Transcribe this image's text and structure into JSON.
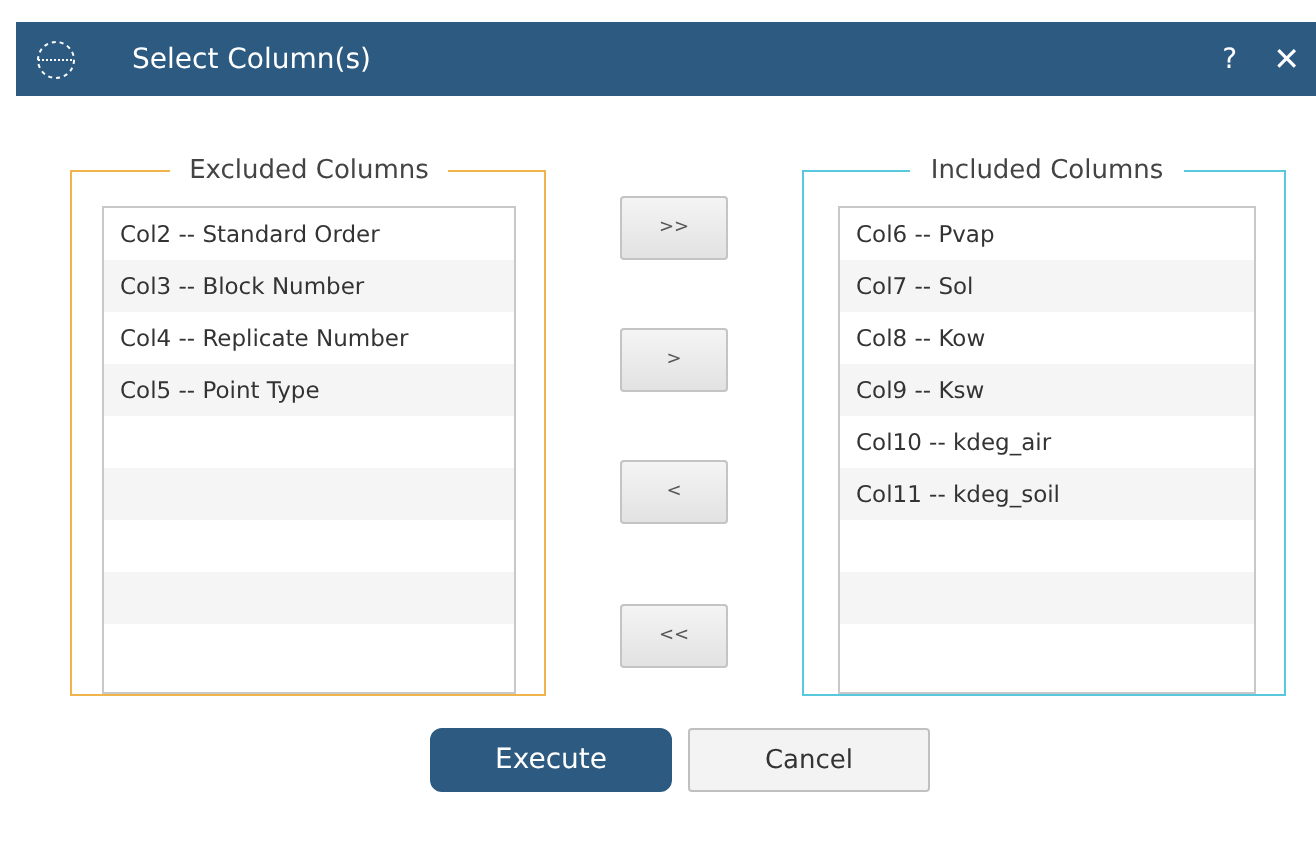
{
  "window": {
    "title": "Select Column(s)",
    "help": "?",
    "close": "✕"
  },
  "excluded": {
    "title": "Excluded Columns",
    "items": [
      "Col2 -- Standard Order",
      "Col3 -- Block Number",
      "Col4 -- Replicate Number",
      "Col5 -- Point Type"
    ]
  },
  "move_buttons": [
    ">>",
    ">",
    "<",
    "<<"
  ],
  "included": {
    "title": "Included Columns",
    "items": [
      "Col6 -- Pvap",
      "Col7 -- Sol",
      "Col8 -- Kow",
      "Col9 -- Ksw",
      "Col10 -- kdeg_air",
      "Col11 -- kdeg_soil"
    ]
  },
  "buttons": [
    {
      "label": "Execute",
      "kind": "primary"
    },
    {
      "label": "Cancel",
      "kind": "secondary"
    }
  ]
}
